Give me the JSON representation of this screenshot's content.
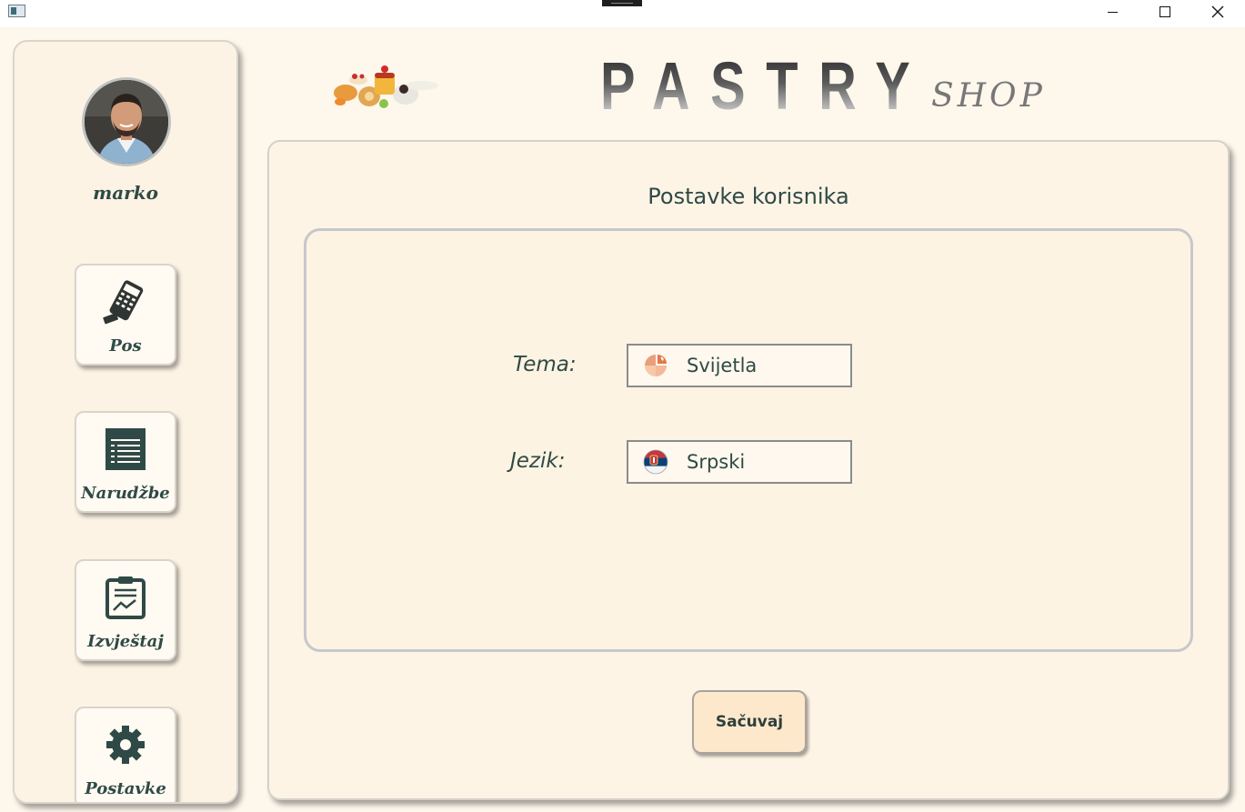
{
  "window": {
    "controls": {
      "minimize_icon": "minimize-icon",
      "maximize_icon": "maximize-icon",
      "close_icon": "close-icon"
    }
  },
  "sidebar": {
    "user": {
      "name": "marko",
      "avatar_icon": "user-avatar"
    },
    "items": [
      {
        "label": "Pos",
        "icon": "pos-terminal-icon"
      },
      {
        "label": "Narudžbe",
        "icon": "order-list-icon"
      },
      {
        "label": "Izvještaj",
        "icon": "report-clipboard-icon"
      },
      {
        "label": "Postavke",
        "icon": "gear-icon"
      }
    ]
  },
  "header": {
    "brand_main": "PASTRY",
    "brand_sub": "SHOP",
    "logo_icon": "pastries-logo"
  },
  "settings": {
    "title": "Postavke korisnika",
    "theme": {
      "label": "Tema:",
      "value": "Svijetla",
      "icon": "theme-palette-icon"
    },
    "language": {
      "label": "Jezik:",
      "value": "Srpski",
      "icon": "serbian-flag-icon"
    },
    "save_label": "Sačuvaj"
  },
  "colors": {
    "background": "#fdf7ec",
    "panel": "#fdf4e6",
    "text": "#2f4a46",
    "save_button": "#fde8cc"
  }
}
